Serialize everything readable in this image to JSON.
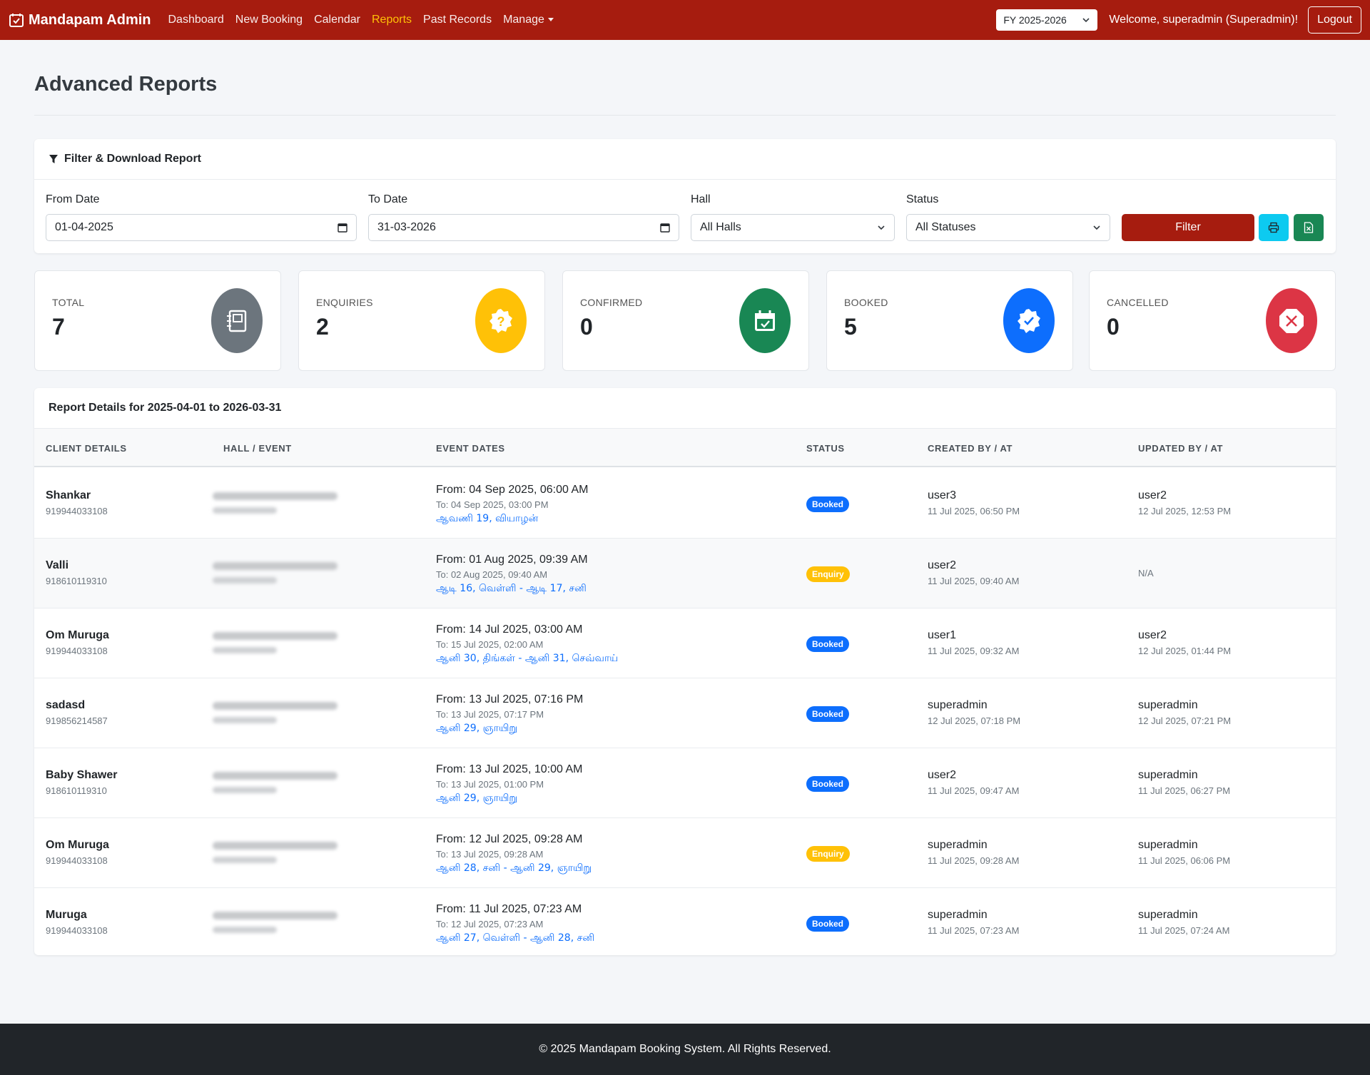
{
  "navbar": {
    "brand": "Mandapam Admin",
    "links": [
      {
        "label": "Dashboard"
      },
      {
        "label": "New Booking"
      },
      {
        "label": "Calendar"
      },
      {
        "label": "Reports"
      },
      {
        "label": "Past Records"
      },
      {
        "label": "Manage"
      }
    ],
    "active_link": "Reports",
    "fy_value": "FY 2025-2026",
    "welcome": "Welcome, superadmin (Superadmin)!",
    "logout": "Logout"
  },
  "page": {
    "title": "Advanced Reports"
  },
  "filter": {
    "header": "Filter & Download Report",
    "from_label": "From Date",
    "from_value": "01-04-2025",
    "to_label": "To Date",
    "to_value": "31-03-2026",
    "hall_label": "Hall",
    "hall_value": "All Halls",
    "status_label": "Status",
    "status_value": "All Statuses",
    "filter_button": "Filter"
  },
  "stats": [
    {
      "label": "TOTAL",
      "value": "7",
      "color": "#6c757d",
      "icon": "journal-icon"
    },
    {
      "label": "ENQUIRIES",
      "value": "2",
      "color": "#ffc107",
      "icon": "question-icon"
    },
    {
      "label": "CONFIRMED",
      "value": "0",
      "color": "#198754",
      "icon": "calendar-check-icon"
    },
    {
      "label": "BOOKED",
      "value": "5",
      "color": "#0d6efd",
      "icon": "patch-check-icon"
    },
    {
      "label": "CANCELLED",
      "value": "0",
      "color": "#dc3545",
      "icon": "octagon-x-icon"
    }
  ],
  "table": {
    "title": "Report Details for 2025-04-01 to 2026-03-31",
    "headers": [
      "CLIENT DETAILS",
      "HALL / EVENT",
      "EVENT DATES",
      "STATUS",
      "CREATED BY / AT",
      "UPDATED BY / AT"
    ],
    "rows": [
      {
        "name": "Shankar",
        "phone": "919944033108",
        "from": "From: 04 Sep 2025, 06:00 AM",
        "to": "To: 04 Sep 2025, 03:00 PM",
        "tamil": "ஆவணி 19, வியாழன்",
        "status": "Booked",
        "created_by": "user3",
        "created_at": "11 Jul 2025, 06:50 PM",
        "updated_by": "user2",
        "updated_at": "12 Jul 2025, 12:53 PM"
      },
      {
        "name": "Valli",
        "phone": "918610119310",
        "from": "From: 01 Aug 2025, 09:39 AM",
        "to": "To: 02 Aug 2025, 09:40 AM",
        "tamil": "ஆடி 16, வெள்ளி - ஆடி 17, சனி",
        "status": "Enquiry",
        "created_by": "user2",
        "created_at": "11 Jul 2025, 09:40 AM",
        "updated_by": "N/A",
        "updated_at": ""
      },
      {
        "name": "Om Muruga",
        "phone": "919944033108",
        "from": "From: 14 Jul 2025, 03:00 AM",
        "to": "To: 15 Jul 2025, 02:00 AM",
        "tamil": "ஆனி 30, திங்கள் - ஆனி 31, செவ்வாய்",
        "status": "Booked",
        "created_by": "user1",
        "created_at": "11 Jul 2025, 09:32 AM",
        "updated_by": "user2",
        "updated_at": "12 Jul 2025, 01:44 PM"
      },
      {
        "name": "sadasd",
        "phone": "919856214587",
        "from": "From: 13 Jul 2025, 07:16 PM",
        "to": "To: 13 Jul 2025, 07:17 PM",
        "tamil": "ஆனி 29, ஞாயிறு",
        "status": "Booked",
        "created_by": "superadmin",
        "created_at": "12 Jul 2025, 07:18 PM",
        "updated_by": "superadmin",
        "updated_at": "12 Jul 2025, 07:21 PM"
      },
      {
        "name": "Baby Shawer",
        "phone": "918610119310",
        "from": "From: 13 Jul 2025, 10:00 AM",
        "to": "To: 13 Jul 2025, 01:00 PM",
        "tamil": "ஆனி 29, ஞாயிறு",
        "status": "Booked",
        "created_by": "user2",
        "created_at": "11 Jul 2025, 09:47 AM",
        "updated_by": "superadmin",
        "updated_at": "11 Jul 2025, 06:27 PM"
      },
      {
        "name": "Om Muruga",
        "phone": "919944033108",
        "from": "From: 12 Jul 2025, 09:28 AM",
        "to": "To: 13 Jul 2025, 09:28 AM",
        "tamil": "ஆனி 28, சனி - ஆனி 29, ஞாயிறு",
        "status": "Enquiry",
        "created_by": "superadmin",
        "created_at": "11 Jul 2025, 09:28 AM",
        "updated_by": "superadmin",
        "updated_at": "11 Jul 2025, 06:06 PM"
      },
      {
        "name": "Muruga",
        "phone": "919944033108",
        "from": "From: 11 Jul 2025, 07:23 AM",
        "to": "To: 12 Jul 2025, 07:23 AM",
        "tamil": "ஆனி 27, வெள்ளி - ஆனி 28, சனி",
        "status": "Booked",
        "created_by": "superadmin",
        "created_at": "11 Jul 2025, 07:23 AM",
        "updated_by": "superadmin",
        "updated_at": "11 Jul 2025, 07:24 AM"
      }
    ]
  },
  "footer": {
    "text": "© 2025 Mandapam Booking System. All Rights Reserved."
  }
}
